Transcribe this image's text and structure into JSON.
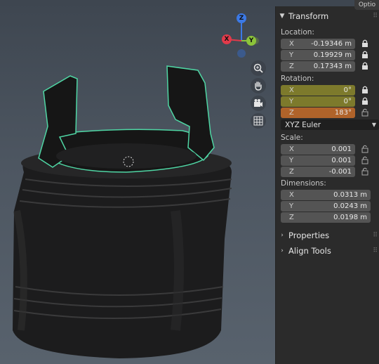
{
  "panel": {
    "tab_label": "Optio",
    "transform_title": "Transform",
    "location": {
      "label": "Location:",
      "rows": [
        {
          "axis": "X",
          "value": "-0.19346 m"
        },
        {
          "axis": "Y",
          "value": "0.19929 m"
        },
        {
          "axis": "Z",
          "value": "0.17343 m"
        }
      ]
    },
    "rotation": {
      "label": "Rotation:",
      "rows": [
        {
          "axis": "X",
          "value": "0°"
        },
        {
          "axis": "Y",
          "value": "0°"
        },
        {
          "axis": "Z",
          "value": "183°"
        }
      ],
      "mode": "XYZ Euler"
    },
    "scale": {
      "label": "Scale:",
      "rows": [
        {
          "axis": "X",
          "value": "0.001"
        },
        {
          "axis": "Y",
          "value": "0.001"
        },
        {
          "axis": "Z",
          "value": "-0.001"
        }
      ]
    },
    "dimensions": {
      "label": "Dimensions:",
      "rows": [
        {
          "axis": "X",
          "value": "0.0313 m"
        },
        {
          "axis": "Y",
          "value": "0.0243 m"
        },
        {
          "axis": "Z",
          "value": "0.0198 m"
        }
      ]
    },
    "properties_title": "Properties",
    "align_tools_title": "Align Tools"
  },
  "gizmo": {
    "z_label": "Z",
    "x_label": "X",
    "y_label": "Y",
    "colors": {
      "x": "#e23a4a",
      "y": "#8cc43a",
      "z": "#3b79e6"
    }
  },
  "viewport_buttons": [
    "zoom-icon",
    "hand-pan-icon",
    "camera-icon",
    "grid-icon"
  ]
}
